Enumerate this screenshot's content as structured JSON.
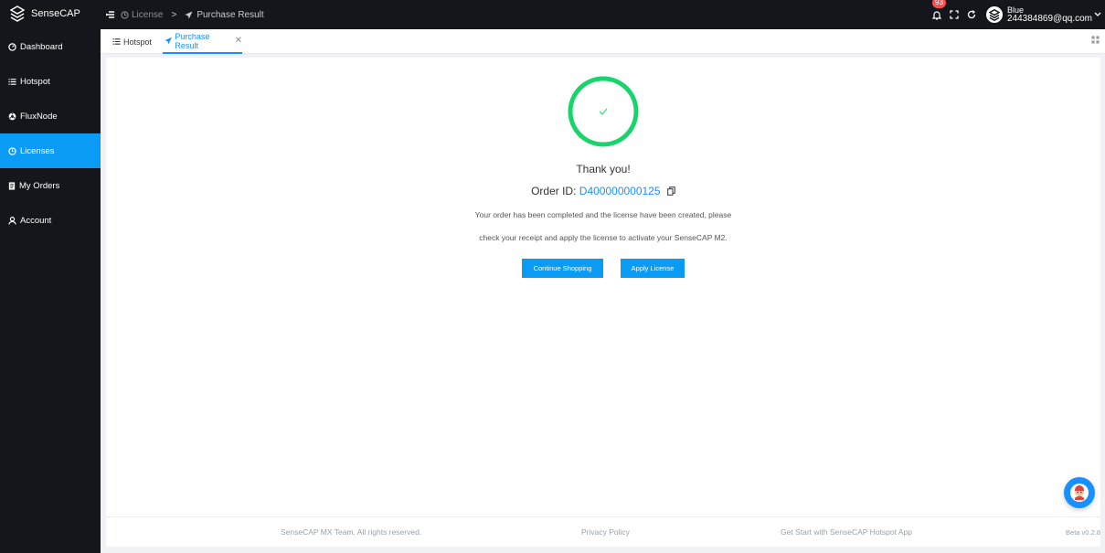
{
  "app": {
    "name": "SenseCAP",
    "logo_icon": "sensecap-logo-icon"
  },
  "breadcrumb": {
    "parent": "License",
    "separator": ">",
    "current": "Purchase Result"
  },
  "header": {
    "notification_count": "93",
    "user_name": "Blue",
    "user_email": "244384869@qq.com"
  },
  "sidebar": {
    "items": [
      {
        "label": "Dashboard",
        "icon": "dashboard-icon"
      },
      {
        "label": "Hotspot",
        "icon": "list-icon"
      },
      {
        "label": "FluxNode",
        "icon": "flux-icon"
      },
      {
        "label": "Licenses",
        "icon": "license-icon",
        "active": true
      },
      {
        "label": "My Orders",
        "icon": "orders-icon"
      },
      {
        "label": "Account",
        "icon": "account-icon"
      }
    ]
  },
  "tabs": [
    {
      "label": "Hotspot",
      "icon": "list-icon"
    },
    {
      "label": "Purchase Result",
      "icon": "send-icon",
      "active": true
    }
  ],
  "result": {
    "title": "Thank you!",
    "order_label": "Order ID:",
    "order_id": "D400000000125",
    "message_line1": "Your order has been completed and the license have been created, please",
    "message_line2": "check your receipt and apply the license to activate your SenseCAP M2.",
    "continue_label": "Continue Shopping",
    "apply_label": "Apply License"
  },
  "footer": {
    "copyright": "SenseCAP MX Team. All rights reserved.",
    "privacy": "Privacy Policy",
    "get_start": "Get Start with SenseCAP Hotspot App",
    "version": "Beta v0.2.8"
  },
  "colors": {
    "accent": "#0a9cf5",
    "success": "#19d46b",
    "sidebar_bg": "#14161b"
  }
}
